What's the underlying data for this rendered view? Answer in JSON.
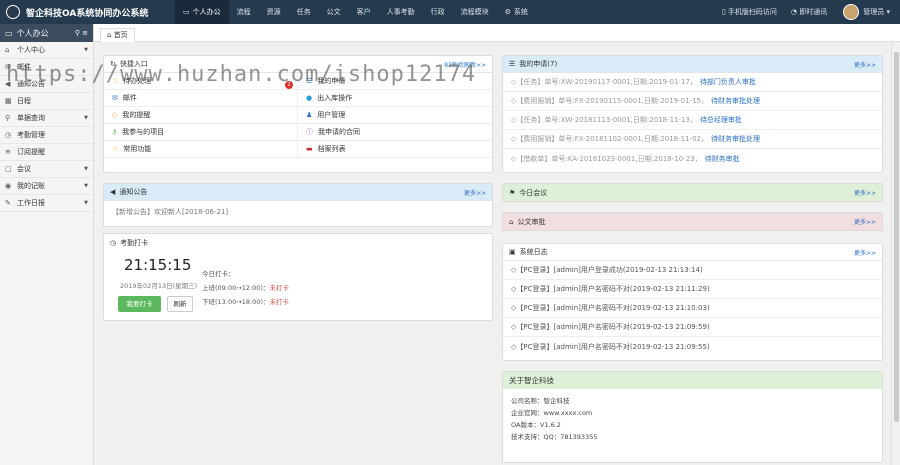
{
  "app": {
    "title": "智企科技OA系统协同办公系统"
  },
  "nav": [
    {
      "label": "个人办公",
      "icon": "monitor-icon",
      "active": true
    },
    {
      "label": "流程"
    },
    {
      "label": "资源"
    },
    {
      "label": "任务"
    },
    {
      "label": "公文"
    },
    {
      "label": "客户"
    },
    {
      "label": "人事考勤"
    },
    {
      "label": "行政"
    },
    {
      "label": "流程模块"
    },
    {
      "label": "系统",
      "icon": "gear-icon"
    }
  ],
  "topright": {
    "mobile": "手机版扫码访问",
    "chat": "即时通讯",
    "user": "管理员"
  },
  "sidebar": {
    "head": "个人办公",
    "items": [
      {
        "label": "个人中心",
        "icon": "user-icon",
        "caret": true
      },
      {
        "label": "邮件",
        "icon": "mail-icon"
      },
      {
        "label": "通知公告",
        "icon": "speaker-icon"
      },
      {
        "label": "日程",
        "icon": "calendar-icon"
      },
      {
        "label": "单据查询",
        "icon": "search-icon",
        "caret": true
      },
      {
        "label": "考勤管理",
        "icon": "clock-icon"
      },
      {
        "label": "订阅提醒",
        "icon": "rss-icon"
      },
      {
        "label": "会议",
        "icon": "bookmark-icon",
        "caret": true
      },
      {
        "label": "我的记账",
        "icon": "coins-icon",
        "caret": true
      },
      {
        "label": "工作日报",
        "icon": "edit-icon",
        "caret": true
      }
    ]
  },
  "tab": {
    "label": "首页",
    "icon": "home-icon"
  },
  "watermark": "https://www.huzhan.com/ishop12174",
  "quick": {
    "title": "快捷入口",
    "refresh": "82秒后刷新>>",
    "items": [
      {
        "label": "待办处理",
        "icon": "star-icon",
        "color": "#e0a030"
      },
      {
        "label": "我的申请",
        "icon": "list-icon",
        "color": "#2a6fc9"
      },
      {
        "label": "邮件",
        "icon": "mail-icon",
        "color": "#2a6fc9"
      },
      {
        "label": "出入库操作",
        "icon": "box-icon",
        "color": "#2a9fd8"
      },
      {
        "label": "我的提醒",
        "icon": "bell-icon",
        "color": "#e0a030"
      },
      {
        "label": "用户管理",
        "icon": "user-icon",
        "color": "#2a6fc9"
      },
      {
        "label": "我参与的项目",
        "icon": "key-icon",
        "color": "#5cb85c"
      },
      {
        "label": "我申请的合同",
        "icon": "info-icon",
        "color": "#8e5cc9"
      },
      {
        "label": "常用功能",
        "icon": "star-icon",
        "color": "#e0a030"
      },
      {
        "label": "档案列表",
        "icon": "folder-icon",
        "color": "#c9302c"
      }
    ],
    "badge": "2"
  },
  "notice": {
    "title": "通知公告",
    "more": "更多>>",
    "rows": [
      "【新增公告】欢迎新人[2018-06-21]"
    ]
  },
  "clock": {
    "title": "考勤打卡",
    "time": "21:15:15",
    "date": "2019年02月13日(星期三)",
    "btn_punch": "我要打卡",
    "btn_refresh": "刷新",
    "today": "今日打卡：",
    "am": "上班(09:00→12:00)：",
    "am_status": "未打卡",
    "pm": "下班(13:00→18:00)：",
    "pm_status": "未打卡"
  },
  "applications": {
    "title": "我的申请(7)",
    "more": "更多>>",
    "rows": [
      {
        "pre": "◇【任务】单号:XW-20190117-0001,日期:2019-01-17，",
        "link": "待部门负责人审批"
      },
      {
        "pre": "◇【费用报销】单号:FX-20190115-0001,日期:2019-01-15，",
        "link": "待财务审批处理"
      },
      {
        "pre": "◇【任务】单号:XW-20181113-0001,日期:2018-11-13，",
        "link": "待总经理审批"
      },
      {
        "pre": "◇【费用报销】单号:FX-20181102-0001,日期:2018-11-02，",
        "link": "待财务审批处理"
      },
      {
        "pre": "◇【借款单】单号:KA-20181023-0001,日期:2018-10-23，",
        "link": "待财务审批"
      }
    ]
  },
  "meeting": {
    "title": "今日会议",
    "more": "更多>>"
  },
  "docs": {
    "title": "公文审批",
    "more": "更多>>"
  },
  "log": {
    "title": "系统日志",
    "more": "更多>>",
    "rows": [
      "◇【PC登录】[admin]用户登录成功(2019-02-13 21:13:14)",
      "◇【PC登录】[admin]用户名密码不对(2019-02-13 21:11:29)",
      "◇【PC登录】[admin]用户名密码不对(2019-02-13 21:10:03)",
      "◇【PC登录】[admin]用户名密码不对(2019-02-13 21:09:59)",
      "◇【PC登录】[admin]用户名密码不对(2019-02-13 21:09:55)"
    ]
  },
  "about": {
    "title": "关于智企科技",
    "lines": [
      "公司名称：智企科技",
      "企业官网：www.xxxx.com",
      "OA版本：V1.6.2",
      "技术支持：QQ：781393355"
    ]
  }
}
